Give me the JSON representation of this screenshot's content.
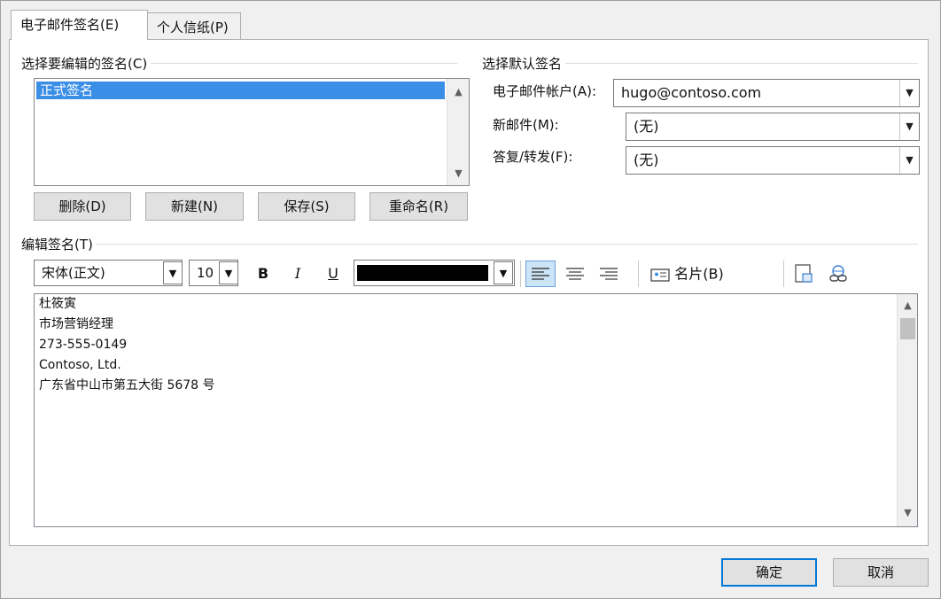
{
  "tabs": {
    "email_signature": "电子邮件签名(E)",
    "personal_stationery": "个人信纸(P)"
  },
  "select_signature": {
    "heading": "选择要编辑的签名(C)",
    "items": [
      "正式签名"
    ],
    "buttons": {
      "delete": "删除(D)",
      "new": "新建(N)",
      "save": "保存(S)",
      "rename": "重命名(R)"
    }
  },
  "default_signature": {
    "heading": "选择默认签名",
    "account_label": "电子邮件帐户(A):",
    "account_value": "hugo@contoso.com",
    "new_messages_label": "新邮件(M):",
    "new_messages_value": "(无)",
    "replies_label": "答复/转发(F):",
    "replies_value": "(无)"
  },
  "edit_signature": {
    "heading": "编辑签名(T)",
    "font": "宋体(正文)",
    "size": "10",
    "bold": "B",
    "italic": "I",
    "underline": "U",
    "font_color": "#000000",
    "business_card": "名片(B)",
    "lines": [
      "杜筱寅",
      "市场营销经理",
      "273-555-0149",
      "Contoso, Ltd.",
      "广东省中山市第五大街 5678 号"
    ]
  },
  "footer": {
    "ok": "确定",
    "cancel": "取消"
  },
  "colors": {
    "selection": "#3b8ee6",
    "active_align": "#cce4f7",
    "primary_border": "#0078d7"
  },
  "icons": [
    "chevron-up-icon",
    "chevron-down-icon",
    "align-left-icon",
    "align-center-icon",
    "align-right-icon",
    "business-card-icon",
    "insert-picture-icon",
    "hyperlink-icon"
  ]
}
